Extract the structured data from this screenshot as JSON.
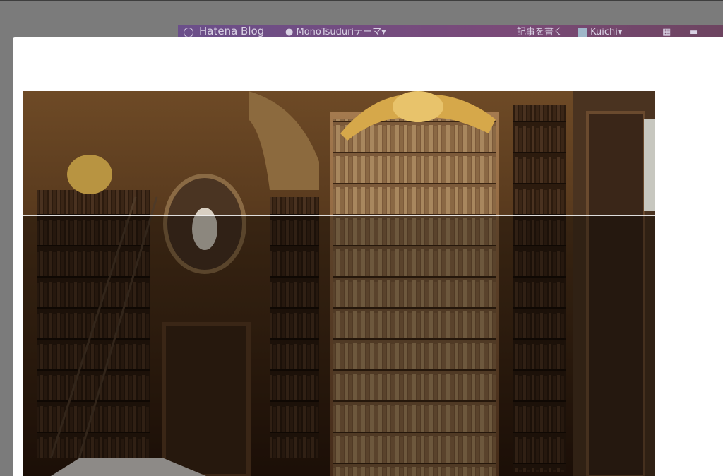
{
  "hatena": {
    "brand": "Hatena Blog",
    "blog_name": "MonoTsuduriテーマ",
    "write_label": "記事を書く",
    "user_label": "Kuichi",
    "colors": {
      "bar": "#6b4f8a",
      "notification": "#d3262d"
    }
  },
  "viewer": {
    "image_alt": "library bookshelves",
    "background_color": "#7b7b7b"
  }
}
